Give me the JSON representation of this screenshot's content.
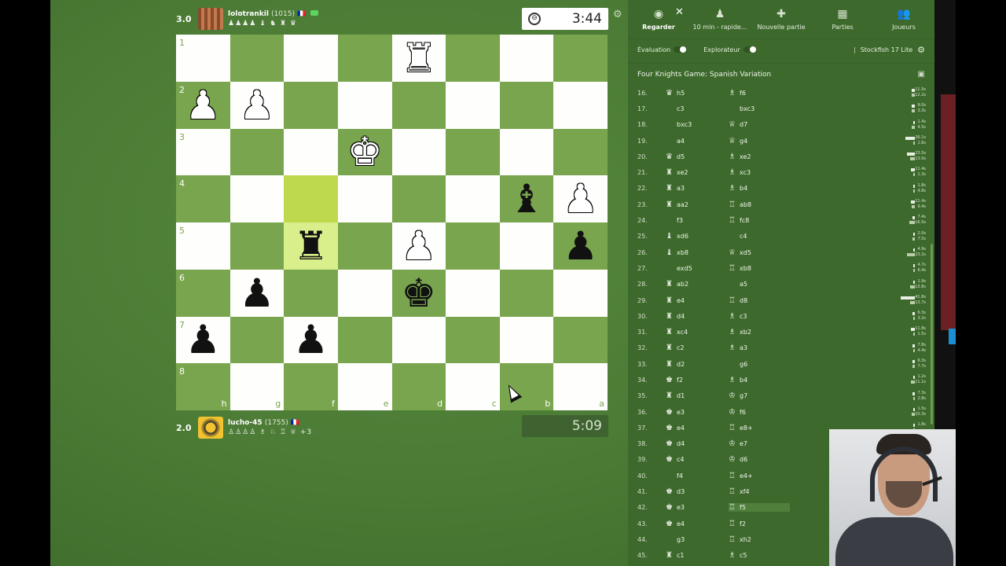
{
  "top_player": {
    "score": "3.0",
    "name": "lolotrankil",
    "rating": "(1015)",
    "flag": "🇫🇷",
    "captured": "♟♟♟♟ ♝ ♞ ♜ ♛",
    "clock": "3:44",
    "clock_icon": "⊖"
  },
  "bottom_player": {
    "score": "2.0",
    "name": "lucho-45",
    "rating": "(1755)",
    "flag": "🇫🇷",
    "captured": "♙♙♙♙ ♗ ♘ ♖ ♕ +3",
    "clock": "5:09"
  },
  "board": {
    "light_color": "#fefffc",
    "dark_color": "#79a54e",
    "rank_labels": [
      "1",
      "2",
      "3",
      "4",
      "5",
      "6",
      "7",
      "8"
    ],
    "file_labels": [
      "h",
      "g",
      "f",
      "e",
      "d",
      "c",
      "b",
      "a"
    ],
    "squares": [
      [
        "",
        "",
        "",
        "",
        "wR",
        "",
        "",
        ""
      ],
      [
        "wP",
        "wP",
        "",
        "",
        "",
        "",
        "",
        ""
      ],
      [
        "",
        "",
        "",
        "wK",
        "",
        "",
        "",
        ""
      ],
      [
        "",
        "",
        "",
        "",
        "",
        "",
        "bB",
        "wP"
      ],
      [
        "",
        "",
        "bR",
        "",
        "wP",
        "",
        "",
        "bP"
      ],
      [
        "",
        "bP",
        "",
        "",
        "bK",
        "",
        "",
        ""
      ],
      [
        "bP",
        "",
        "bP",
        "",
        "",
        "",
        "",
        ""
      ],
      [
        "",
        "",
        "",
        "",
        "",
        "",
        "",
        ""
      ]
    ],
    "highlighted": [
      "3-2",
      "4-2"
    ]
  },
  "panel": {
    "close_label": "✕",
    "tabs": [
      {
        "label": "Regarder",
        "icon": "◉",
        "active": true
      },
      {
        "label": "10 min - rapide...",
        "icon": "♟",
        "active": false
      },
      {
        "label": "Nouvelle partie",
        "icon": "✚",
        "active": false
      },
      {
        "label": "Parties",
        "icon": "▦",
        "active": false
      },
      {
        "label": "Joueurs",
        "icon": "👥",
        "active": false
      }
    ],
    "evaluation_label": "Évaluation",
    "explorer_label": "Explorateur",
    "engine_label": "Stockfish 17 Lite",
    "opening": "Four Knights Game: Spanish Variation",
    "moves": [
      {
        "n": "16.",
        "w_icon": "♛",
        "w": "h5",
        "b_icon": "♗",
        "b": "f6"
      },
      {
        "n": "17.",
        "w_icon": "",
        "w": "c3",
        "b_icon": "",
        "b": "bxc3"
      },
      {
        "n": "18.",
        "w_icon": "",
        "w": "bxc3",
        "b_icon": "♕",
        "b": "d7"
      },
      {
        "n": "19.",
        "w_icon": "",
        "w": "a4",
        "b_icon": "♕",
        "b": "g4"
      },
      {
        "n": "20.",
        "w_icon": "♛",
        "w": "d5",
        "b_icon": "♗",
        "b": "xe2"
      },
      {
        "n": "21.",
        "w_icon": "♜",
        "w": "xe2",
        "b_icon": "♗",
        "b": "xc3"
      },
      {
        "n": "22.",
        "w_icon": "♜",
        "w": "a3",
        "b_icon": "♗",
        "b": "b4"
      },
      {
        "n": "23.",
        "w_icon": "♜",
        "w": "aa2",
        "b_icon": "♖",
        "b": "ab8"
      },
      {
        "n": "24.",
        "w_icon": "",
        "w": "f3",
        "b_icon": "♖",
        "b": "fc8"
      },
      {
        "n": "25.",
        "w_icon": "♝",
        "w": "xd6",
        "b_icon": "",
        "b": "c4"
      },
      {
        "n": "26.",
        "w_icon": "♝",
        "w": "xb8",
        "b_icon": "♕",
        "b": "xd5"
      },
      {
        "n": "27.",
        "w_icon": "",
        "w": "exd5",
        "b_icon": "♖",
        "b": "xb8"
      },
      {
        "n": "28.",
        "w_icon": "♜",
        "w": "ab2",
        "b_icon": "",
        "b": "a5"
      },
      {
        "n": "29.",
        "w_icon": "♜",
        "w": "e4",
        "b_icon": "♖",
        "b": "d8"
      },
      {
        "n": "30.",
        "w_icon": "♜",
        "w": "d4",
        "b_icon": "♗",
        "b": "c3"
      },
      {
        "n": "31.",
        "w_icon": "♜",
        "w": "xc4",
        "b_icon": "♗",
        "b": "xb2"
      },
      {
        "n": "32.",
        "w_icon": "♜",
        "w": "c2",
        "b_icon": "♗",
        "b": "a3"
      },
      {
        "n": "33.",
        "w_icon": "♜",
        "w": "d2",
        "b_icon": "",
        "b": "g6"
      },
      {
        "n": "34.",
        "w_icon": "♚",
        "w": "f2",
        "b_icon": "♗",
        "b": "b4"
      },
      {
        "n": "35.",
        "w_icon": "♜",
        "w": "d1",
        "b_icon": "♔",
        "b": "g7"
      },
      {
        "n": "36.",
        "w_icon": "♚",
        "w": "e3",
        "b_icon": "♔",
        "b": "f6"
      },
      {
        "n": "37.",
        "w_icon": "♚",
        "w": "e4",
        "b_icon": "♖",
        "b": "e8+"
      },
      {
        "n": "38.",
        "w_icon": "♚",
        "w": "d4",
        "b_icon": "♔",
        "b": "e7"
      },
      {
        "n": "39.",
        "w_icon": "♚",
        "w": "c4",
        "b_icon": "♔",
        "b": "d6"
      },
      {
        "n": "40.",
        "w_icon": "",
        "w": "f4",
        "b_icon": "♖",
        "b": "e4+"
      },
      {
        "n": "41.",
        "w_icon": "♚",
        "w": "d3",
        "b_icon": "♖",
        "b": "xf4"
      },
      {
        "n": "42.",
        "w_icon": "♚",
        "w": "e3",
        "b_icon": "♖",
        "b": "f5",
        "current": true
      },
      {
        "n": "43.",
        "w_icon": "♚",
        "w": "e4",
        "b_icon": "♖",
        "b": "f2"
      },
      {
        "n": "44.",
        "w_icon": "",
        "w": "g3",
        "b_icon": "♖",
        "b": "xh2"
      },
      {
        "n": "45.",
        "w_icon": "♜",
        "w": "c1",
        "b_icon": "♗",
        "b": "c5"
      }
    ],
    "time_bars": [
      {
        "w": 0.1,
        "b": 0.1,
        "wt": "11.5s",
        "bt": "12.2s"
      },
      {
        "w": 0.1,
        "b": 0.1,
        "wt": "9.0s",
        "bt": "3.3s"
      },
      {
        "w": 0.05,
        "b": 0.1,
        "wt": "1.4s",
        "bt": "4.5s"
      },
      {
        "w": 0.3,
        "b": 0.05,
        "wt": "26.1s",
        "bt": "1.6s"
      },
      {
        "w": 0.25,
        "b": 0.15,
        "wt": "23.5s",
        "bt": "13.0s"
      },
      {
        "w": 0.12,
        "b": 0.03,
        "wt": "11.4s",
        "bt": "1.3s"
      },
      {
        "w": 0.03,
        "b": 0.05,
        "wt": "1.8s",
        "bt": "4.8s"
      },
      {
        "w": 0.12,
        "b": 0.1,
        "wt": "11.4s",
        "bt": "9.4s"
      },
      {
        "w": 0.08,
        "b": 0.18,
        "wt": "7.4s",
        "bt": "16.5s"
      },
      {
        "w": 0.03,
        "b": 0.08,
        "wt": "2.0s",
        "bt": "7.5s"
      },
      {
        "w": 0.05,
        "b": 0.25,
        "wt": "4.9s",
        "bt": "23.2s"
      },
      {
        "w": 0.05,
        "b": 0.06,
        "wt": "4.7s",
        "bt": "6.4s"
      },
      {
        "w": 0.02,
        "b": 0.14,
        "wt": "1.9s",
        "bt": "13.8s"
      },
      {
        "w": 0.45,
        "b": 0.14,
        "wt": "41.8s",
        "bt": "13.7s"
      },
      {
        "w": 0.07,
        "b": 0.03,
        "wt": "6.3s",
        "bt": "3.2s"
      },
      {
        "w": 0.12,
        "b": 0.02,
        "wt": "11.8s",
        "bt": "1.5s"
      },
      {
        "w": 0.08,
        "b": 0.04,
        "wt": "7.8s",
        "bt": "4.4s"
      },
      {
        "w": 0.07,
        "b": 0.08,
        "wt": "6.3s",
        "bt": "7.7s"
      },
      {
        "w": 0.02,
        "b": 0.12,
        "wt": "1.2s",
        "bt": "11.1s"
      },
      {
        "w": 0.07,
        "b": 0.03,
        "wt": "7.3s",
        "bt": "2.8s"
      },
      {
        "w": 0.02,
        "b": 0.11,
        "wt": "1.5s",
        "bt": "10.3s"
      },
      {
        "w": 0.02,
        "b": 0.0,
        "wt": "1.8s",
        "bt": ""
      }
    ]
  }
}
